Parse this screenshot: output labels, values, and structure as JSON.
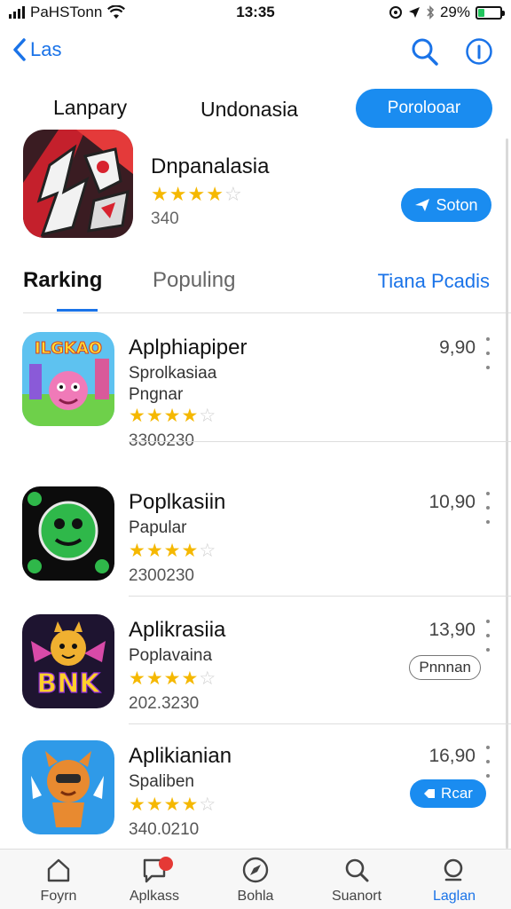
{
  "status_bar": {
    "carrier": "PaHSTonn",
    "time": "13:35",
    "battery": "29%",
    "battery_level": 0.29
  },
  "nav": {
    "back_label": "Las"
  },
  "top_tabs": {
    "tab1": "Lanpary",
    "tab2": "Undonasia",
    "primary_button": "Porolooar"
  },
  "featured": {
    "title": "Dnpanalasia",
    "rating": 4,
    "count": "340",
    "button_label": "Soton"
  },
  "segments": {
    "ranking": "Rarking",
    "popular": "Populing",
    "more": "Tiana Pcadis"
  },
  "apps": [
    {
      "name": "Aplphiapiper",
      "sub1": "Sprolkasiaa",
      "sub2": "Pngnar",
      "rating": 3.5,
      "count": "3300230",
      "price": "9,90",
      "button": null
    },
    {
      "name": "Poplkasiin",
      "sub1": "Papular",
      "sub2": "",
      "rating": 3.5,
      "count": "2300230",
      "price": "10,90",
      "button": null
    },
    {
      "name": "Aplikrasiia",
      "sub1": "Poplavaina",
      "sub2": "",
      "rating": 3.5,
      "count": "202.3230",
      "price": "13,90",
      "button": "Pnnnan"
    },
    {
      "name": "Aplikianian",
      "sub1": "Spaliben",
      "sub2": "",
      "rating": 3.5,
      "count": "340.0210",
      "price": "16,90",
      "button_filled": "Rcar"
    }
  ],
  "app_icon_text": {
    "app1": "ILGKAO",
    "app3": "BNK"
  },
  "tab_bar": {
    "t1": "Foyrn",
    "t2": "Aplkass",
    "t3": "Bohla",
    "t4": "Suanort",
    "t5": "Laglan"
  },
  "colors": {
    "accent": "#1a8cf0",
    "star": "#f5b800",
    "link": "#1a73e8",
    "badge": "#e53935"
  }
}
